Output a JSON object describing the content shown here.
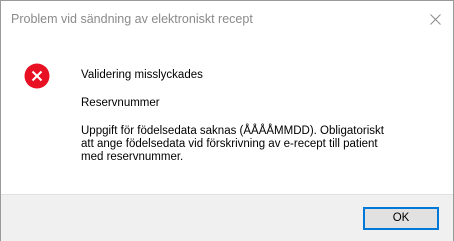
{
  "window": {
    "title": "Problem vid sändning av elektroniskt recept",
    "close_icon": "close-icon"
  },
  "message": {
    "icon": "error-icon",
    "icon_color": "#e81123",
    "heading": "Validering misslyckades",
    "subheading": "Reservnummer",
    "details_lines": [
      "Uppgift för födelsedata saknas (ÅÅÅÅMMDD). Obligatoriskt",
      "att ange födelsedata vid förskrivning av e-recept till patient",
      "med reservnummer."
    ]
  },
  "buttons": {
    "ok_label": "OK"
  },
  "colors": {
    "accent": "#0078d7",
    "footer_bg": "#f0f0f0"
  }
}
